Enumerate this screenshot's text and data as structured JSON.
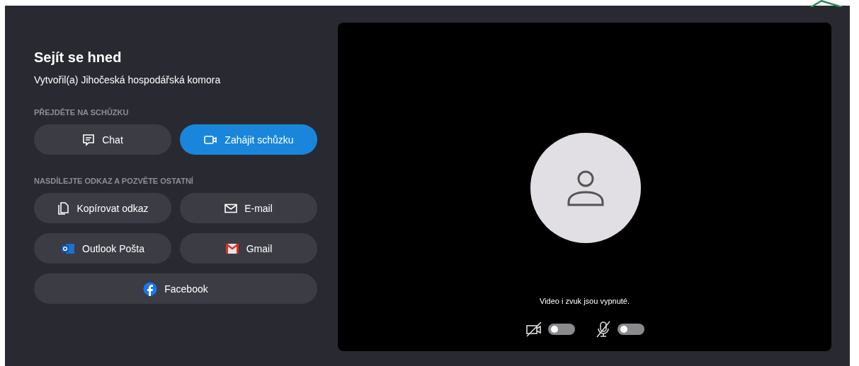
{
  "meeting": {
    "title": "Sejít se hned",
    "creator": "Vytvořil(a) Jihočeská hospodářská komora"
  },
  "join_section": {
    "heading": "PŘEJDĚTE NA SCHŮZKU",
    "buttons": [
      {
        "label": "Chat",
        "kind": "chat",
        "primary": false
      },
      {
        "label": "Zahájit schůzku",
        "kind": "camera",
        "primary": true
      }
    ]
  },
  "share_section": {
    "heading": "NASDÍLEJTE ODKAZ A POZVĚTE OSTATNÍ",
    "buttons": [
      {
        "label": "Kopírovat odkaz",
        "kind": "copy",
        "primary": false
      },
      {
        "label": "E-mail",
        "kind": "mail",
        "primary": false
      },
      {
        "label": "Outlook Pošta",
        "kind": "outlook",
        "primary": false
      },
      {
        "label": "Gmail",
        "kind": "gmail",
        "primary": false
      },
      {
        "label": "Facebook",
        "kind": "facebook",
        "primary": false
      }
    ]
  },
  "preview": {
    "status": "Video i zvuk jsou vypnuté.",
    "toggles": [
      {
        "kind": "camera",
        "on": false
      },
      {
        "kind": "microphone",
        "on": false
      }
    ]
  }
}
